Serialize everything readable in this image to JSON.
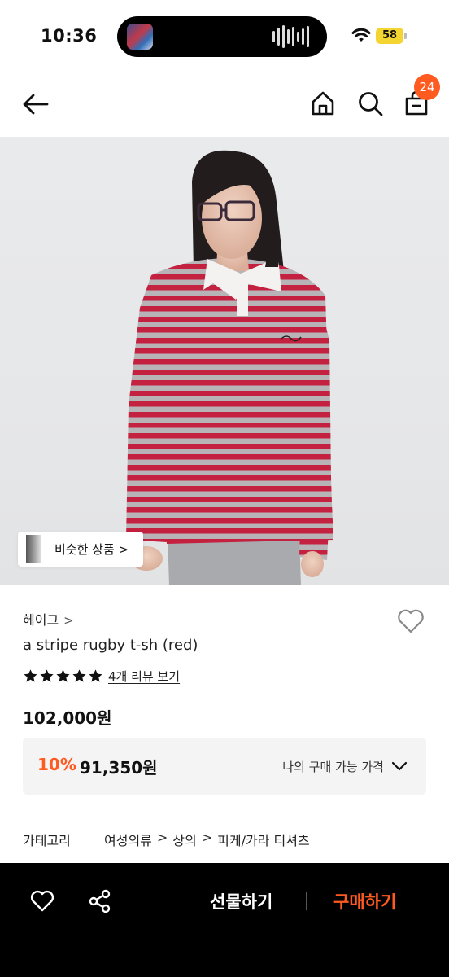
{
  "status_bar": {
    "time": "10:36",
    "battery": "58"
  },
  "nav": {
    "cart_count": "24"
  },
  "image": {
    "similar_label": "비슷한 상품 >"
  },
  "product": {
    "brand": "헤이그",
    "brand_chevron": ">",
    "name": "a stripe rugby t-sh (red)",
    "rating_stars": 5,
    "review_link": "4개 리뷰 보기",
    "price": "102,000원"
  },
  "price_box": {
    "discount": "10%",
    "sale_price": "91,350원",
    "my_price_label": "나의 구매 가능 가격"
  },
  "category": {
    "label": "카테고리",
    "path": [
      "여성의류",
      "상의",
      "피케/카라 티셔츠"
    ],
    "separator": ">"
  },
  "bottom_bar": {
    "gift_label": "선물하기",
    "buy_label": "구매하기"
  },
  "colors": {
    "accent": "#ff5a1f",
    "shirt_red": "#c42040",
    "shirt_grey": "#b5b0b4"
  }
}
